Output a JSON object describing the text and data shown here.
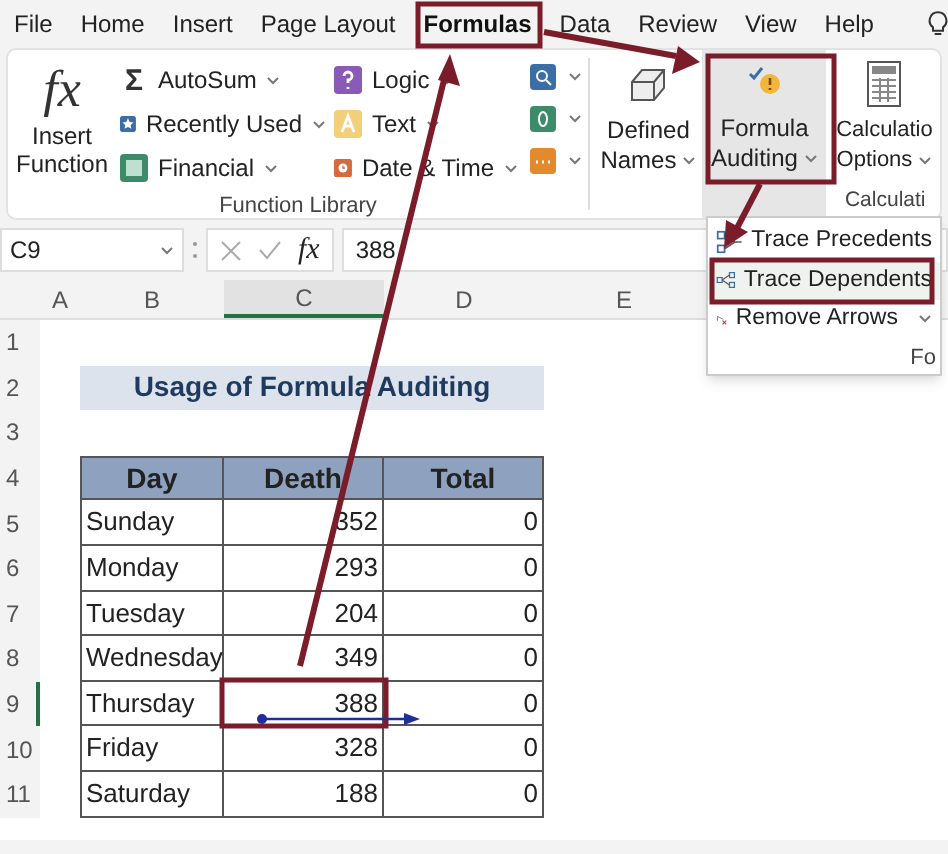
{
  "menu_tabs": [
    {
      "label": "File",
      "selected": false
    },
    {
      "label": "Home",
      "selected": false
    },
    {
      "label": "Insert",
      "selected": false
    },
    {
      "label": "Page Layout",
      "selected": false
    },
    {
      "label": "Formulas",
      "selected": true
    },
    {
      "label": "Data",
      "selected": false
    },
    {
      "label": "Review",
      "selected": false
    },
    {
      "label": "View",
      "selected": false
    },
    {
      "label": "Help",
      "selected": false
    }
  ],
  "ribbon": {
    "insert_function": {
      "glyph": "fx",
      "lines": [
        "Insert",
        "Function"
      ]
    },
    "function_library_items": [
      {
        "kind": "sigma",
        "label": "AutoSum",
        "glyph": "Σ"
      },
      {
        "kind": "star",
        "label": "Recently Used"
      },
      {
        "kind": "book",
        "label": "Financial"
      },
      {
        "kind": "question",
        "label": "Logic"
      },
      {
        "kind": "letter",
        "label": "Text"
      },
      {
        "kind": "clock",
        "label": "Date & Time"
      }
    ],
    "function_library_label": "Function Library",
    "defined_names": {
      "lines": [
        "Defined",
        "Names"
      ]
    },
    "formula_auditing": {
      "lines": [
        "Formula",
        "Auditing"
      ],
      "pressed": true
    },
    "calculation_options": {
      "lines": [
        "Calculatio",
        "Options"
      ]
    },
    "calculation_label": "Calculati"
  },
  "formula_bar": {
    "name_box": "C9",
    "fx": "fx",
    "value": "388"
  },
  "columns": [
    {
      "label": "A",
      "selected": false
    },
    {
      "label": "B",
      "selected": false
    },
    {
      "label": "C",
      "selected": true
    },
    {
      "label": "D",
      "selected": false
    },
    {
      "label": "E",
      "selected": false
    }
  ],
  "sheet": {
    "title": "Usage of Formula Auditing",
    "headers": [
      "Day",
      "Death",
      "Total"
    ],
    "rows": [
      {
        "row": "5",
        "day": "Sunday",
        "death": "352",
        "total": "0",
        "selected": false
      },
      {
        "row": "6",
        "day": "Monday",
        "death": "293",
        "total": "0",
        "selected": false
      },
      {
        "row": "7",
        "day": "Tuesday",
        "death": "204",
        "total": "0",
        "selected": false
      },
      {
        "row": "8",
        "day": "Wednesday",
        "death": "349",
        "total": "0",
        "selected": false
      },
      {
        "row": "9",
        "day": "Thursday",
        "death": "388",
        "total": "0",
        "selected": true
      },
      {
        "row": "10",
        "day": "Friday",
        "death": "328",
        "total": "0",
        "selected": false
      },
      {
        "row": "11",
        "day": "Saturday",
        "death": "188",
        "total": "0",
        "selected": false
      }
    ],
    "top_rows": [
      "1",
      "2",
      "3",
      "4"
    ]
  },
  "auditing_menu": {
    "items": [
      {
        "kind": "precedents",
        "label": "Trace Precedents",
        "highlighted": false,
        "dropdown": false
      },
      {
        "kind": "dependents",
        "label": "Trace Dependents",
        "highlighted": true,
        "dropdown": false
      },
      {
        "kind": "remove",
        "label": "Remove Arrows",
        "highlighted": false,
        "dropdown": true
      }
    ],
    "group_label": "Fo"
  }
}
